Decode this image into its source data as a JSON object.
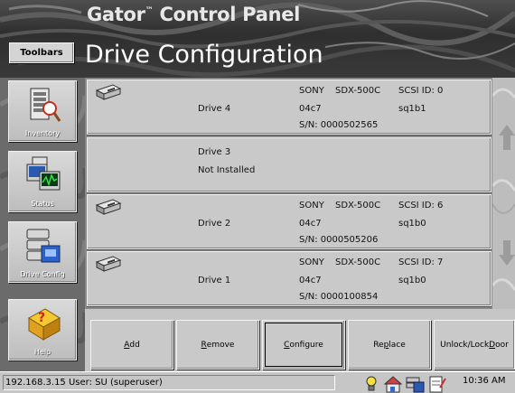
{
  "header": {
    "app_title": "Gator",
    "app_title_mark": "™",
    "app_title_rest": " Control Panel",
    "page_title": "Drive Configuration",
    "toolbars_label": "Toolbars"
  },
  "sidebar": {
    "items": [
      {
        "label": "Inventory",
        "icon": "inventory-icon"
      },
      {
        "label": "Status",
        "icon": "status-icon"
      },
      {
        "label": "Drive Config",
        "icon": "drive-config-icon"
      },
      {
        "label": "Help",
        "icon": "help-icon"
      }
    ]
  },
  "drives": [
    {
      "name": "Drive 4",
      "status": "",
      "installed": true,
      "vendor": "SONY",
      "model": "SDX-500C",
      "revision": "04c7",
      "serial": "S/N: 0000502565",
      "scsi": "SCSI ID: 0",
      "device": "sq1b1"
    },
    {
      "name": "Drive 3",
      "status": "Not Installed",
      "installed": false,
      "vendor": "",
      "model": "",
      "revision": "",
      "serial": "",
      "scsi": "",
      "device": ""
    },
    {
      "name": "Drive 2",
      "status": "",
      "installed": true,
      "vendor": "SONY",
      "model": "SDX-500C",
      "revision": "04c7",
      "serial": "S/N: 0000505206",
      "scsi": "SCSI ID: 6",
      "device": "sq1b0"
    },
    {
      "name": "Drive 1",
      "status": "",
      "installed": true,
      "vendor": "SONY",
      "model": "SDX-500C",
      "revision": "04c7",
      "serial": "S/N: 0000100854",
      "scsi": "SCSI ID: 7",
      "device": "sq1b0"
    }
  ],
  "actions": {
    "add_pre": "",
    "add_u": "A",
    "add_post": "dd",
    "remove_pre": "",
    "remove_u": "R",
    "remove_post": "emove",
    "configure_pre": "",
    "configure_u": "C",
    "configure_post": "onfigure",
    "replace_pre": "Re",
    "replace_u": "p",
    "replace_post": "lace",
    "unlock_pre": "Unlock/Lock ",
    "unlock_u": "D",
    "unlock_post": "oor"
  },
  "status_bar": {
    "text": "192.168.3.15 User: SU (superuser)",
    "tray_icons": [
      "lightbulb-icon",
      "network-icon",
      "drives-icon",
      "notepad-icon"
    ],
    "clock": "10:36 AM"
  },
  "colors": {
    "header_bg": "#3a3a3a",
    "rail_bg": "#6b6b6b",
    "row_bg": "#c9c9c9",
    "scroll_arrow": "#9c9c9c"
  }
}
